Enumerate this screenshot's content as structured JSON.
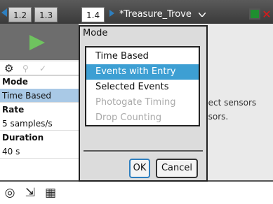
{
  "tabs": [
    {
      "label": "1.2"
    },
    {
      "label": "1.3"
    },
    {
      "label": "1.4"
    }
  ],
  "document": {
    "title": "*Treasure_Trove"
  },
  "sidebar": {
    "mode_label": "Mode",
    "mode_value": "Time Based",
    "rate_label": "Rate",
    "rate_value": "5 samples/s",
    "duration_label": "Duration",
    "duration_value": "40 s"
  },
  "background_text": {
    "line1": "nect sensors",
    "line2": "nsors."
  },
  "dialog": {
    "title": "Mode",
    "options": [
      {
        "label": "Time Based",
        "state": "normal"
      },
      {
        "label": "Events with Entry",
        "state": "selected"
      },
      {
        "label": "Selected Events",
        "state": "normal"
      },
      {
        "label": "Photogate Timing",
        "state": "disabled"
      },
      {
        "label": "Drop Counting",
        "state": "disabled"
      }
    ],
    "ok_label": "OK",
    "cancel_label": "Cancel"
  },
  "icons": {
    "gear": "⚙",
    "marker": "⚲",
    "check": "✓",
    "meter": "◎",
    "graph": "⇲",
    "table": "▦"
  },
  "colors": {
    "accent": "#3d9fd3",
    "play": "#6fc35f",
    "close": "#e01818",
    "battery": "#1f8f2f"
  }
}
